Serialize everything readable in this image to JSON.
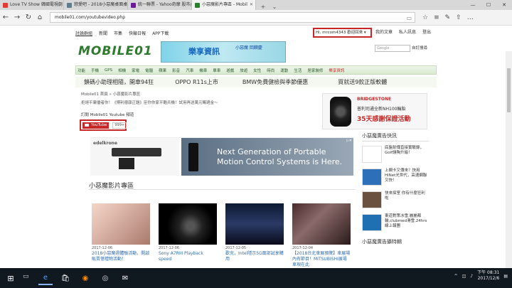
{
  "browser": {
    "tabs": [
      {
        "label": "Love TV Show 韓國電視劇",
        "fav": "#e53935"
      },
      {
        "label": "戀愛吧 - 2018小惡魔桌面桌",
        "fav": "#607d8b"
      },
      {
        "label": "統一聯票 - Yahoo奇摩 股市/",
        "fav": "#6a1b9a"
      },
      {
        "label": "小惡魔影片專區 - Mobil",
        "fav": "#2e7d32"
      }
    ],
    "url": "mobile01.com/youtubevideo.php"
  },
  "site": {
    "topnav": [
      "討論群組",
      "新聞",
      "市集",
      "快顯日報",
      "APP下載"
    ],
    "user": "Hi, mrcom4343 歡迎回來 ▾",
    "topright": [
      "我的文章",
      "私人訊息",
      "登出"
    ],
    "logo": "MOBILE01",
    "banner": {
      "title": "樂享資訊",
      "tag": "小惡魔 回饋慶"
    },
    "search_placeholder": "Google",
    "search_button": "自訂搜尋",
    "categories": [
      "功能",
      "手機",
      "GPS",
      "相機",
      "家電",
      "電腦",
      "蘋果",
      "影音",
      "汽車",
      "機車",
      "單車",
      "遊戲",
      "旅遊",
      "女性",
      "時尚",
      "運動",
      "生活",
      "居家裝修",
      "樂享資訊"
    ],
    "promos": [
      "鎖碼小助理相隨，開車94狂",
      "OPPO R11s上市",
      "BMW免費健檢與季節優惠",
      "買就送9款正版軟體"
    ]
  },
  "content": {
    "breadcrumb": "Mobile01 首頁 » 小惡魔影片專區",
    "subtitle": "拒絕平庸優者你！《博利德康正題》臣你你家平酷兵機！試用再送萬元賜適金～",
    "subscribe_text": "訂閱 Mobile01 Youtube 頻道",
    "youtube_label": "YouTube",
    "youtube_count": "999+",
    "ad_right": {
      "brand": "BRIDGESTONE",
      "line1": "普利司通全新NH100輪胎",
      "line2": "35天感謝保證活動"
    },
    "video_ad": {
      "brand": "edelkrone",
      "headline": "Next Generation of Portable Motion Control Systems is Here."
    },
    "section_title": "小惡魔影片專區",
    "videos": [
      {
        "date": "2017-12-06",
        "title": "2018小惡魔週體驗活動，開啟販賣億禮物活動！"
      },
      {
        "date": "2017-12-06",
        "title": "Sony A7RIII Playback speed"
      },
      {
        "date": "2017-12-05",
        "title": "歡充，Intel隱示5G面部試享購用"
      },
      {
        "date": "2017-12-04",
        "title": "【2018台北車展預覽】車展場內有節目！MITSUBISHI展場車現在此"
      }
    ]
  },
  "sidebar": {
    "title": "小惡魔廣告快訊",
    "items": [
      {
        "text": "底盤耐傳直接實驗錄，Golf讓陶升級！"
      },
      {
        "text": "上網卡又傳來？快用HiNet光世代，高速網聯又快！"
      },
      {
        "text": "快來探室 你有什麼狂利啦"
      },
      {
        "text": "東道對策冰雪,麗麗都輪,clubmed滑雪,24hrs線上報團"
      }
    ],
    "title2": "小惡魔廣告攝特輯"
  },
  "taskbar": {
    "time": "下午 08:31",
    "date": "2017/12/6"
  }
}
